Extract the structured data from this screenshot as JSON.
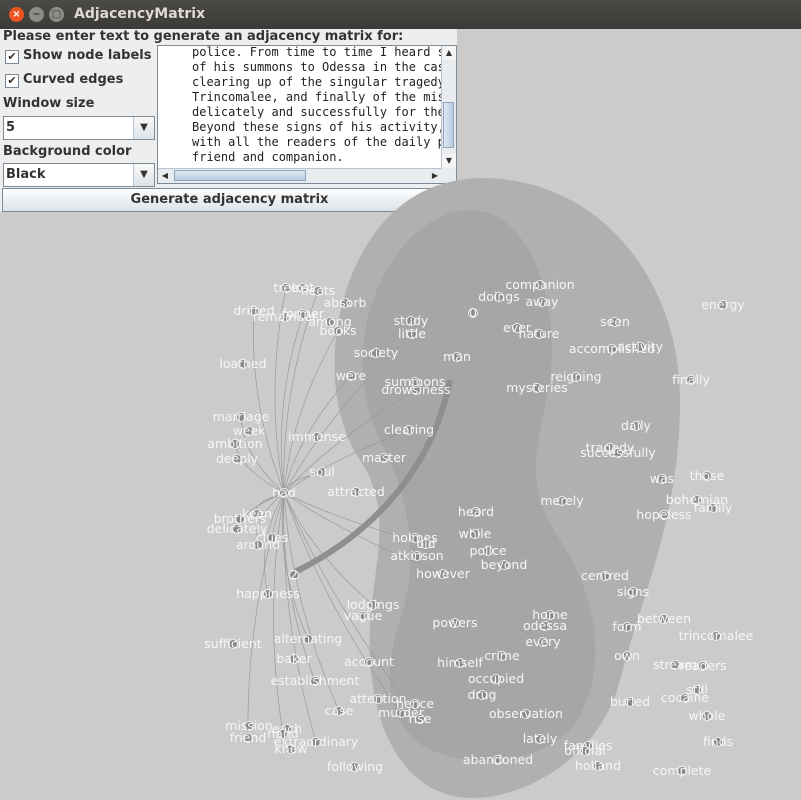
{
  "window": {
    "title": "AdjacencyMatrix",
    "close_glyph": "×",
    "minimize_glyph": "−",
    "maximize_glyph": "□"
  },
  "controls": {
    "prompt": "Please enter text to generate an adjacency matrix for:",
    "show_node_labels": {
      "label": "Show node labels",
      "checked": true,
      "glyph": "✔"
    },
    "curved_edges": {
      "label": "Curved edges",
      "checked": true,
      "glyph": "✔"
    },
    "window_size": {
      "label": "Window size",
      "value": "5"
    },
    "background_color": {
      "label": "Background color",
      "value": "Black"
    },
    "combo_arrow_glyph": "▼",
    "generate_button": "Generate adjacency matrix"
  },
  "text_input": {
    "lines": [
      "police. From time to time I heard s",
      "of his summons to Odessa in the cas",
      "clearing up of the singular tragedy",
      "Trincomalee, and finally of the mis",
      "delicately and successfully for the",
      "Beyond these signs of his activity,",
      "with all the readers of the daily p",
      "friend and companion."
    ],
    "scroll_up_glyph": "▲",
    "scroll_down_glyph": "▼",
    "scroll_left_glyph": "◀",
    "scroll_right_glyph": "▶"
  },
  "graph": {
    "node_labels": [
      "tree",
      "lost",
      "fleets",
      "absorb",
      "drifted",
      "remainder",
      "former",
      "among",
      "books",
      "loathed",
      "marriage",
      "week",
      "ambition",
      "deeply",
      "had",
      "immense",
      "soul",
      "attracted",
      "keen",
      "brothers",
      "delicately",
      "clues",
      "around",
      "2",
      "happiness",
      "sufficient",
      "alternating",
      "baker",
      "establishment",
      "mission",
      "friend",
      "each",
      "hand",
      "knew",
      "extraordinary",
      "following",
      "case",
      "attention",
      "murder",
      "hence",
      "rise",
      "account",
      "lodgings",
      "vague",
      "powers",
      "heard",
      "while",
      "holmes",
      "old",
      "atkinson",
      "police",
      "beyond",
      "however",
      "home",
      "odessa",
      "every",
      "crime",
      "himself",
      "occupied",
      "drug",
      "observation",
      "lately",
      "abandoned",
      "study",
      "little",
      "society",
      "were",
      "summons",
      "drowsiness",
      "0",
      "man",
      "doings",
      "companion",
      "away",
      "ever",
      "nature",
      "mysteries",
      "reigning",
      "clearing",
      "master",
      "merely",
      "seen",
      "accomplished",
      "activity",
      "energy",
      "finally",
      "daily",
      "tragedy",
      "successfully",
      "was",
      "those",
      "bohemian",
      "hopeless",
      "family",
      "centred",
      "signs",
      "between",
      "form",
      "trincomalee",
      "own",
      "stream",
      "readers",
      "buried",
      "cocaine",
      "still",
      "whole",
      "finds",
      "families",
      "official",
      "holland",
      "complete"
    ]
  }
}
